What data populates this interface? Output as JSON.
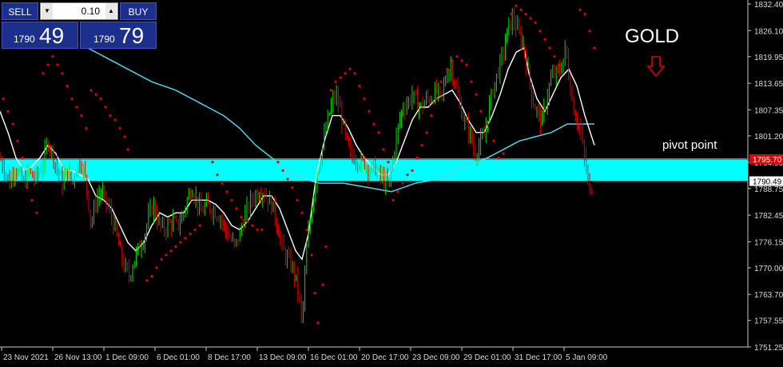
{
  "trade_panel": {
    "sell_label": "SELL",
    "buy_label": "BUY",
    "lot_value": "0.10",
    "bid_small": "1790",
    "bid_big": "49",
    "ask_small": "1790",
    "ask_big": "79"
  },
  "annotations": {
    "title": "GOLD",
    "pivot_label": "pivot point",
    "arrow_icon": "down-arrow-icon",
    "arrow_color": "#e00000",
    "zone_color": "#00ffff"
  },
  "chart_data": {
    "type": "candlestick",
    "symbol": "GOLD",
    "ylim": [
      1751.25,
      1832.4
    ],
    "y_ticks": [
      "1832.40",
      "1826.10",
      "1819.95",
      "1813.65",
      "1807.35",
      "1801.20",
      "1794.95",
      "1788.75",
      "1782.45",
      "1776.15",
      "1770.00",
      "1763.70",
      "1757.55",
      "1751.25"
    ],
    "x_ticks": [
      "23 Nov 2021",
      "26 Nov 13:00",
      "1 Dec 09:00",
      "6 Dec 01:00",
      "8 Dec 17:00",
      "13 Dec 09:00",
      "16 Dec 01:00",
      "20 Dec 17:00",
      "23 Dec 09:00",
      "29 Dec 01:00",
      "31 Dec 17:00",
      "5 Jan 09:00"
    ],
    "price_labels": {
      "red_line": "1795.70",
      "current": "1790.49"
    },
    "pivot_zone": [
      1790.5,
      1795.9
    ],
    "colors": {
      "up": "#00e000",
      "down": "#e00000",
      "slow_ma": "#4fd6e8",
      "fast_ma": "#ffffff",
      "sar": "#e00000"
    },
    "close_path": [
      [
        0,
        1796
      ],
      [
        6,
        1793
      ],
      [
        12,
        1790
      ],
      [
        18,
        1794
      ],
      [
        24,
        1792
      ],
      [
        30,
        1790
      ],
      [
        36,
        1793
      ],
      [
        42,
        1791
      ],
      [
        48,
        1792
      ],
      [
        54,
        1795
      ],
      [
        60,
        1800
      ],
      [
        66,
        1797
      ],
      [
        72,
        1793
      ],
      [
        78,
        1790
      ],
      [
        84,
        1793
      ],
      [
        90,
        1790
      ],
      [
        96,
        1794
      ],
      [
        102,
        1795
      ],
      [
        108,
        1790
      ],
      [
        114,
        1780
      ],
      [
        120,
        1786
      ],
      [
        126,
        1788
      ],
      [
        132,
        1786
      ],
      [
        138,
        1783
      ],
      [
        144,
        1779
      ],
      [
        150,
        1774
      ],
      [
        156,
        1770
      ],
      [
        162,
        1768
      ],
      [
        168,
        1772
      ],
      [
        174,
        1775
      ],
      [
        180,
        1777
      ],
      [
        186,
        1782
      ],
      [
        192,
        1785
      ],
      [
        198,
        1781
      ],
      [
        204,
        1779
      ],
      [
        210,
        1780
      ],
      [
        216,
        1781
      ],
      [
        222,
        1780
      ],
      [
        228,
        1782
      ],
      [
        234,
        1786
      ],
      [
        240,
        1789
      ],
      [
        246,
        1786
      ],
      [
        252,
        1783
      ],
      [
        258,
        1785
      ],
      [
        264,
        1784
      ],
      [
        270,
        1783
      ],
      [
        276,
        1782
      ],
      [
        282,
        1779
      ],
      [
        288,
        1777
      ],
      [
        294,
        1775
      ],
      [
        300,
        1778
      ],
      [
        306,
        1782
      ],
      [
        312,
        1785
      ],
      [
        318,
        1787
      ],
      [
        324,
        1788
      ],
      [
        330,
        1788
      ],
      [
        336,
        1786
      ],
      [
        342,
        1784
      ],
      [
        348,
        1779
      ],
      [
        354,
        1774
      ],
      [
        360,
        1772
      ],
      [
        366,
        1770
      ],
      [
        372,
        1766
      ],
      [
        378,
        1757
      ],
      [
        384,
        1775
      ],
      [
        390,
        1784
      ],
      [
        396,
        1792
      ],
      [
        402,
        1797
      ],
      [
        408,
        1803
      ],
      [
        414,
        1808
      ],
      [
        420,
        1811
      ],
      [
        426,
        1807
      ],
      [
        432,
        1801
      ],
      [
        438,
        1797
      ],
      [
        444,
        1796
      ],
      [
        450,
        1795
      ],
      [
        456,
        1795
      ],
      [
        462,
        1793
      ],
      [
        468,
        1794
      ],
      [
        474,
        1792
      ],
      [
        480,
        1791
      ],
      [
        486,
        1789
      ],
      [
        492,
        1796
      ],
      [
        498,
        1803
      ],
      [
        504,
        1808
      ],
      [
        510,
        1809
      ],
      [
        516,
        1811
      ],
      [
        522,
        1809
      ],
      [
        528,
        1808
      ],
      [
        534,
        1810
      ],
      [
        540,
        1810
      ],
      [
        546,
        1812
      ],
      [
        552,
        1810
      ],
      [
        558,
        1815
      ],
      [
        564,
        1818
      ],
      [
        570,
        1813
      ],
      [
        576,
        1808
      ],
      [
        582,
        1804
      ],
      [
        588,
        1802
      ],
      [
        594,
        1797
      ],
      [
        600,
        1799
      ],
      [
        606,
        1801
      ],
      [
        612,
        1808
      ],
      [
        618,
        1813
      ],
      [
        624,
        1817
      ],
      [
        630,
        1821
      ],
      [
        636,
        1827
      ],
      [
        642,
        1829
      ],
      [
        648,
        1826
      ],
      [
        654,
        1823
      ],
      [
        660,
        1818
      ],
      [
        666,
        1810
      ],
      [
        672,
        1807
      ],
      [
        678,
        1804
      ],
      [
        684,
        1810
      ],
      [
        690,
        1815
      ],
      [
        696,
        1816
      ],
      [
        702,
        1817
      ],
      [
        708,
        1822
      ],
      [
        714,
        1812
      ],
      [
        720,
        1806
      ],
      [
        726,
        1803
      ],
      [
        732,
        1795
      ],
      [
        738,
        1788
      ],
      [
        742,
        1790
      ]
    ],
    "fast_ma_path": [
      [
        0,
        1807
      ],
      [
        10,
        1802
      ],
      [
        20,
        1796
      ],
      [
        30,
        1793
      ],
      [
        40,
        1794
      ],
      [
        50,
        1796
      ],
      [
        60,
        1799
      ],
      [
        70,
        1797
      ],
      [
        80,
        1793
      ],
      [
        90,
        1793
      ],
      [
        100,
        1792
      ],
      [
        110,
        1791
      ],
      [
        120,
        1787
      ],
      [
        130,
        1786
      ],
      [
        140,
        1784
      ],
      [
        150,
        1780
      ],
      [
        160,
        1776
      ],
      [
        170,
        1774
      ],
      [
        180,
        1776
      ],
      [
        190,
        1780
      ],
      [
        200,
        1783
      ],
      [
        210,
        1782
      ],
      [
        220,
        1783
      ],
      [
        230,
        1783
      ],
      [
        240,
        1786
      ],
      [
        250,
        1786
      ],
      [
        260,
        1786
      ],
      [
        270,
        1785
      ],
      [
        280,
        1783
      ],
      [
        290,
        1780
      ],
      [
        300,
        1779
      ],
      [
        310,
        1781
      ],
      [
        320,
        1784
      ],
      [
        330,
        1787
      ],
      [
        340,
        1787
      ],
      [
        350,
        1784
      ],
      [
        360,
        1779
      ],
      [
        370,
        1774
      ],
      [
        378,
        1772
      ],
      [
        386,
        1778
      ],
      [
        396,
        1792
      ],
      [
        406,
        1800
      ],
      [
        416,
        1806
      ],
      [
        426,
        1806
      ],
      [
        436,
        1803
      ],
      [
        446,
        1799
      ],
      [
        456,
        1796
      ],
      [
        466,
        1794
      ],
      [
        476,
        1792
      ],
      [
        486,
        1792
      ],
      [
        496,
        1795
      ],
      [
        506,
        1800
      ],
      [
        516,
        1805
      ],
      [
        526,
        1808
      ],
      [
        536,
        1808
      ],
      [
        546,
        1810
      ],
      [
        556,
        1811
      ],
      [
        566,
        1812
      ],
      [
        576,
        1809
      ],
      [
        586,
        1805
      ],
      [
        596,
        1802
      ],
      [
        606,
        1802
      ],
      [
        616,
        1806
      ],
      [
        626,
        1811
      ],
      [
        636,
        1817
      ],
      [
        646,
        1821
      ],
      [
        656,
        1822
      ],
      [
        662,
        1816
      ],
      [
        672,
        1810
      ],
      [
        682,
        1807
      ],
      [
        692,
        1811
      ],
      [
        702,
        1815
      ],
      [
        712,
        1817
      ],
      [
        722,
        1813
      ],
      [
        732,
        1806
      ],
      [
        744,
        1799
      ]
    ],
    "slow_ma_path": [
      [
        100,
        1823
      ],
      [
        130,
        1820
      ],
      [
        160,
        1817
      ],
      [
        190,
        1814
      ],
      [
        220,
        1812
      ],
      [
        250,
        1809
      ],
      [
        280,
        1806
      ],
      [
        300,
        1803
      ],
      [
        320,
        1799
      ],
      [
        340,
        1796
      ],
      [
        360,
        1793
      ],
      [
        380,
        1791
      ],
      [
        400,
        1790
      ],
      [
        430,
        1790
      ],
      [
        460,
        1789
      ],
      [
        490,
        1788
      ],
      [
        520,
        1790
      ],
      [
        550,
        1791
      ],
      [
        580,
        1794
      ],
      [
        610,
        1796
      ],
      [
        630,
        1798
      ],
      [
        650,
        1800
      ],
      [
        670,
        1801
      ],
      [
        690,
        1802
      ],
      [
        710,
        1804
      ],
      [
        730,
        1804
      ],
      [
        744,
        1804
      ]
    ],
    "sar_points": [
      [
        4,
        1810
      ],
      [
        10,
        1807
      ],
      [
        16,
        1804
      ],
      [
        22,
        1800
      ],
      [
        28,
        1796
      ],
      [
        34,
        1789
      ],
      [
        40,
        1786
      ],
      [
        46,
        1783
      ],
      [
        54,
        1816
      ],
      [
        60,
        1818
      ],
      [
        66,
        1820
      ],
      [
        72,
        1818
      ],
      [
        78,
        1816
      ],
      [
        84,
        1813
      ],
      [
        90,
        1810
      ],
      [
        96,
        1808
      ],
      [
        102,
        1806
      ],
      [
        108,
        1803
      ],
      [
        114,
        1812
      ],
      [
        120,
        1811
      ],
      [
        126,
        1810
      ],
      [
        132,
        1808
      ],
      [
        138,
        1806
      ],
      [
        144,
        1805
      ],
      [
        150,
        1803
      ],
      [
        156,
        1801
      ],
      [
        160,
        1798
      ],
      [
        184,
        1767
      ],
      [
        190,
        1768
      ],
      [
        196,
        1770
      ],
      [
        202,
        1772
      ],
      [
        208,
        1773
      ],
      [
        214,
        1774
      ],
      [
        220,
        1775
      ],
      [
        226,
        1776
      ],
      [
        232,
        1777
      ],
      [
        238,
        1778
      ],
      [
        244,
        1779
      ],
      [
        250,
        1780
      ],
      [
        266,
        1795
      ],
      [
        272,
        1792
      ],
      [
        278,
        1790
      ],
      [
        284,
        1788
      ],
      [
        290,
        1786
      ],
      [
        296,
        1784
      ],
      [
        302,
        1782
      ],
      [
        310,
        1781
      ],
      [
        316,
        1780
      ],
      [
        322,
        1779
      ],
      [
        328,
        1779
      ],
      [
        348,
        1795
      ],
      [
        354,
        1793
      ],
      [
        360,
        1791
      ],
      [
        366,
        1789
      ],
      [
        372,
        1786
      ],
      [
        378,
        1783
      ],
      [
        384,
        1779
      ],
      [
        390,
        1773
      ],
      [
        394,
        1764
      ],
      [
        398,
        1757
      ],
      [
        404,
        1766
      ],
      [
        408,
        1775
      ],
      [
        414,
        1812
      ],
      [
        420,
        1814
      ],
      [
        426,
        1815
      ],
      [
        432,
        1816
      ],
      [
        438,
        1817
      ],
      [
        444,
        1816
      ],
      [
        450,
        1813
      ],
      [
        456,
        1810
      ],
      [
        462,
        1807
      ],
      [
        468,
        1804
      ],
      [
        474,
        1802
      ],
      [
        480,
        1798
      ],
      [
        486,
        1795
      ],
      [
        492,
        1786
      ],
      [
        498,
        1788
      ],
      [
        504,
        1790
      ],
      [
        510,
        1792
      ],
      [
        516,
        1793
      ],
      [
        522,
        1796
      ],
      [
        528,
        1799
      ],
      [
        534,
        1802
      ],
      [
        540,
        1806
      ],
      [
        546,
        1810
      ],
      [
        552,
        1814
      ],
      [
        560,
        1817
      ],
      [
        566,
        1819
      ],
      [
        572,
        1820
      ],
      [
        578,
        1819
      ],
      [
        584,
        1818
      ],
      [
        590,
        1814
      ],
      [
        596,
        1811
      ],
      [
        602,
        1807
      ],
      [
        610,
        1804
      ],
      [
        618,
        1800
      ],
      [
        624,
        1796
      ],
      [
        630,
        1797
      ],
      [
        640,
        1830
      ],
      [
        646,
        1832
      ],
      [
        652,
        1831
      ],
      [
        658,
        1830
      ],
      [
        664,
        1829
      ],
      [
        670,
        1828
      ],
      [
        676,
        1826
      ],
      [
        682,
        1824
      ],
      [
        688,
        1822
      ],
      [
        694,
        1820
      ],
      [
        700,
        1818
      ],
      [
        726,
        1831
      ],
      [
        732,
        1830
      ],
      [
        738,
        1826
      ],
      [
        744,
        1822
      ]
    ]
  }
}
